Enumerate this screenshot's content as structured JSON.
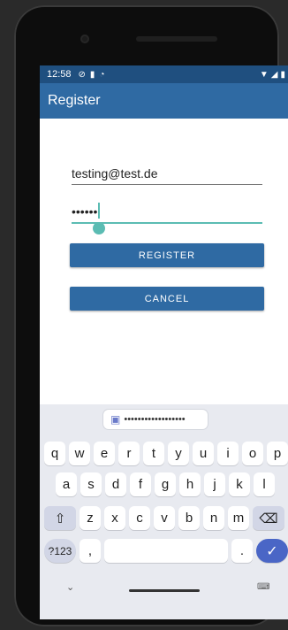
{
  "status_bar": {
    "time": "12:58",
    "icons": [
      "vpn-icon",
      "sim-icon",
      "sync-icon"
    ],
    "right_icons": [
      "wifi-icon",
      "signal-icon",
      "battery-icon"
    ]
  },
  "app_bar": {
    "title": "Register"
  },
  "form": {
    "email_value": "testing@test.de",
    "password_mask": "••••••",
    "register_label": "REGISTER",
    "cancel_label": "CANCEL"
  },
  "keyboard": {
    "suggestion": "••••••••••••••••••",
    "row1": [
      "q",
      "w",
      "e",
      "r",
      "t",
      "y",
      "u",
      "i",
      "o",
      "p"
    ],
    "row2": [
      "a",
      "s",
      "d",
      "f",
      "g",
      "h",
      "j",
      "k",
      "l"
    ],
    "row3": [
      "z",
      "x",
      "c",
      "v",
      "b",
      "n",
      "m"
    ],
    "symbols_label": "?123",
    "comma": ",",
    "period": "."
  },
  "colors": {
    "app_bar": "#2f6aa3",
    "status_bar": "#1f4f7f",
    "accent": "#5bbcb3",
    "enter": "#4a66c6"
  }
}
